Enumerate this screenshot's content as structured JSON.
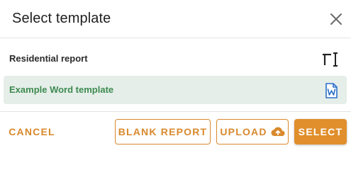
{
  "dialog": {
    "title": "Select template",
    "close_icon": "close-icon"
  },
  "templates": [
    {
      "label": "Residential report",
      "icon": "text-format-icon",
      "selected": false
    },
    {
      "label": "Example Word template",
      "icon": "word-document-icon",
      "selected": true
    }
  ],
  "footer": {
    "cancel_label": "CANCEL",
    "blank_report_label": "BLANK REPORT",
    "upload_label": "UPLOAD",
    "upload_icon": "cloud-upload-icon",
    "select_label": "SELECT"
  },
  "colors": {
    "accent": "#d9892c",
    "accent_fill": "#e08f2c",
    "selected_bg": "#e5eee9",
    "selected_text": "#3d8a4f",
    "word_icon": "#2b6fc9"
  }
}
